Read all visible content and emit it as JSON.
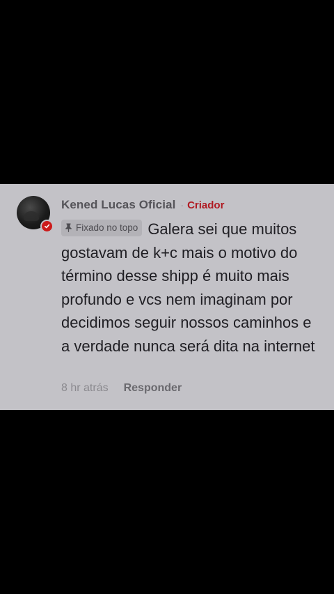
{
  "comment": {
    "author": "Kened Lucas Oficial",
    "separator": "·",
    "creator_badge_label": "Criador",
    "pinned_label": "Fixado no topo",
    "text": "Galera sei que muitos gostavam de k+c mais o motivo do término desse shipp é muito mais profundo e vcs nem imaginam por decidimos seguir nossos caminhos e a verdade nunca será dita na internet",
    "timestamp": "8 hr atrás",
    "reply_label": "Responder",
    "avatar_icon": "avatar",
    "pin_icon": "pin-icon",
    "verified_icon": "creator-check-icon"
  },
  "colors": {
    "background": "#000000",
    "card": "#c3c2c7",
    "creator_accent": "#b01a22",
    "text": "#1f1e23",
    "muted": "#8a898e"
  }
}
